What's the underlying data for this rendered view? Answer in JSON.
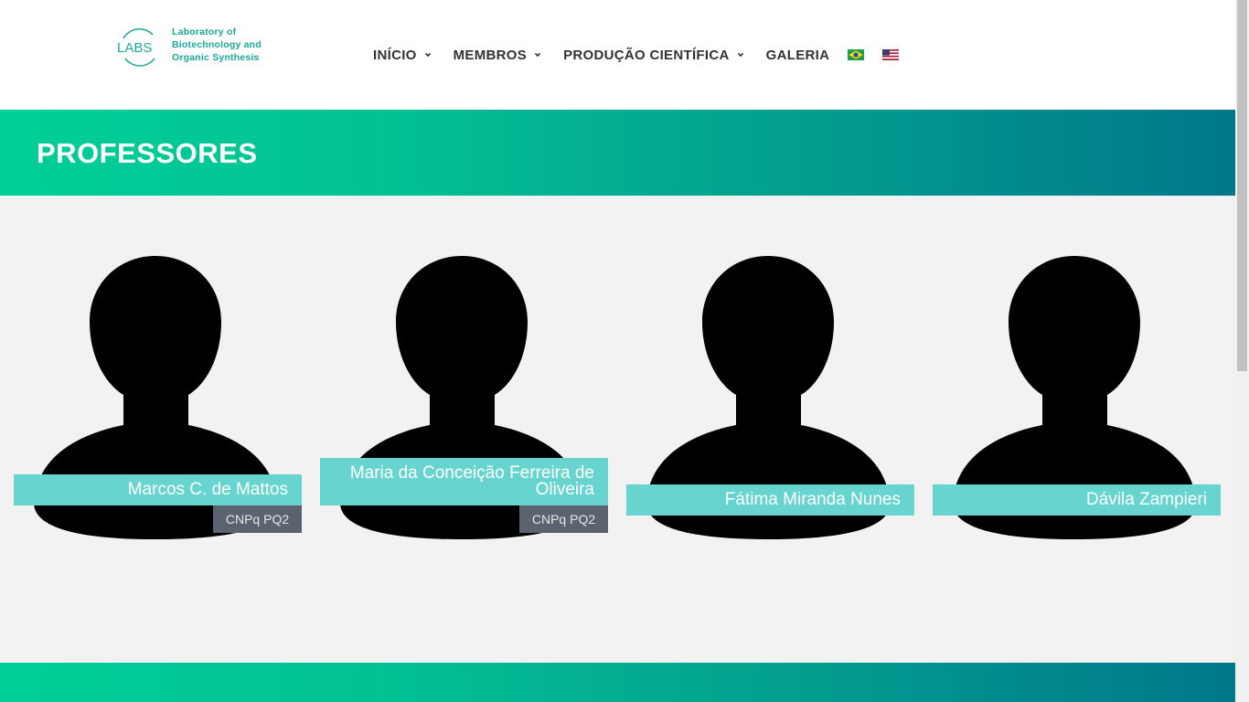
{
  "logo": {
    "mark": "LABS",
    "line1": "Laboratory  of",
    "line2": "Biotechnology  and",
    "line3": "Organic  Synthesis"
  },
  "nav": {
    "items": [
      {
        "label": "INÍCIO",
        "has_dropdown": true
      },
      {
        "label": "MEMBROS",
        "has_dropdown": true
      },
      {
        "label": "PRODUÇÃO CIENTÍFICA",
        "has_dropdown": true
      },
      {
        "label": "GALERIA",
        "has_dropdown": false
      }
    ],
    "languages": [
      "brazil-flag-icon",
      "usa-flag-icon"
    ]
  },
  "banner": {
    "title": "PROFESSORES"
  },
  "professors": [
    {
      "name": "Marcos C. de Mattos",
      "tag": "CNPq PQ2"
    },
    {
      "name": "Maria da Conceição Ferreira de Oliveira",
      "tag": "CNPq PQ2"
    },
    {
      "name": "Fátima Miranda Nunes",
      "tag": ""
    },
    {
      "name": "Dávila Zampieri",
      "tag": ""
    }
  ],
  "colors": {
    "accent": "#68d4cf",
    "gradient_start": "#00cf97",
    "gradient_end": "#00778b",
    "tag_bg": "#5c6370",
    "logo_text": "#1aa99a"
  }
}
